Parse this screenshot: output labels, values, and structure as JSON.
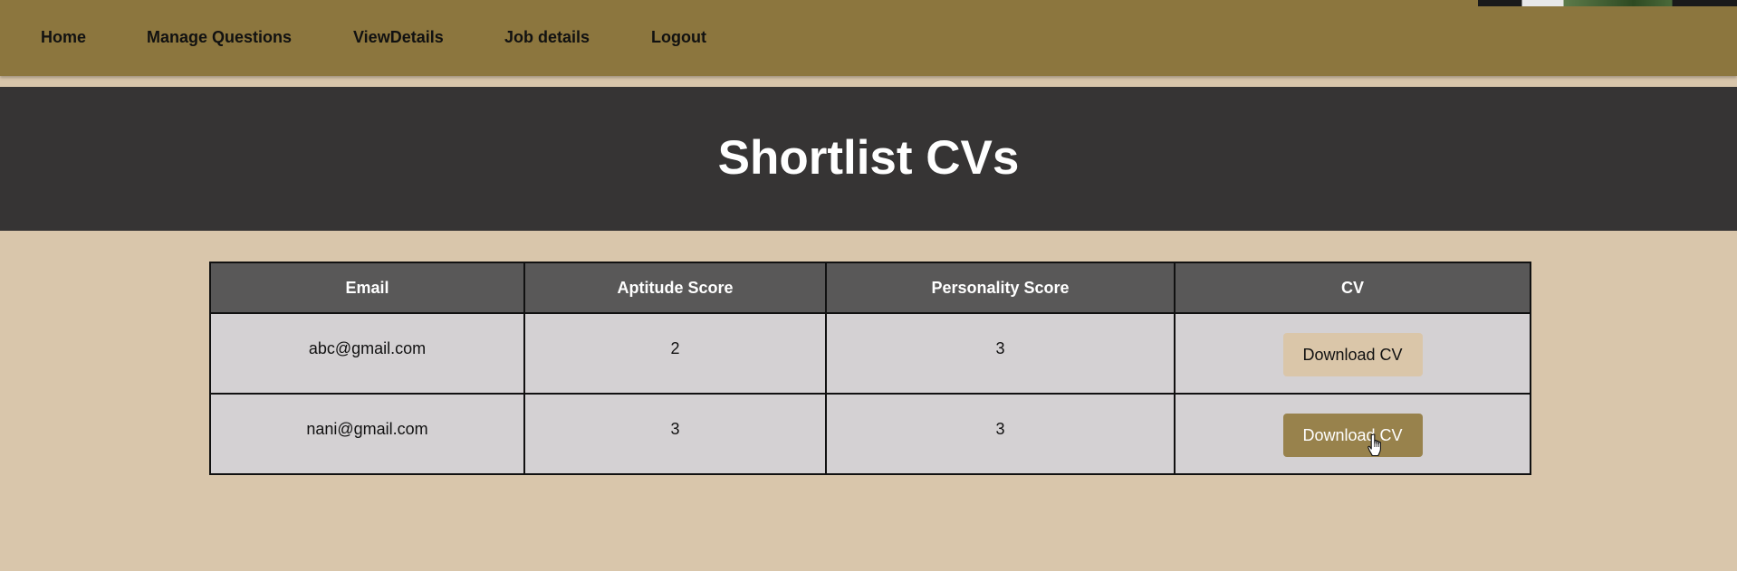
{
  "nav": {
    "items": [
      {
        "label": "Home"
      },
      {
        "label": "Manage Questions"
      },
      {
        "label": "ViewDetails"
      },
      {
        "label": "Job details"
      },
      {
        "label": "Logout"
      }
    ]
  },
  "banner": {
    "title": "Shortlist CVs"
  },
  "table": {
    "headers": [
      "Email",
      "Aptitude Score",
      "Personality Score",
      "CV"
    ],
    "rows": [
      {
        "email": "abc@gmail.com",
        "aptitude": "2",
        "personality": "3",
        "cv_label": "Download CV",
        "hovered": false
      },
      {
        "email": "nani@gmail.com",
        "aptitude": "3",
        "personality": "3",
        "cv_label": "Download CV",
        "hovered": true
      }
    ]
  },
  "colors": {
    "nav_bg": "#8c763e",
    "page_bg": "#d9c6ab",
    "banner_bg": "#363434",
    "table_header_bg": "#595858",
    "table_cell_bg": "#d4d1d3",
    "button_bg": "#dac6a9",
    "button_hover_bg": "#98824c"
  },
  "icons": {
    "cursor": "hand-pointer-icon"
  }
}
